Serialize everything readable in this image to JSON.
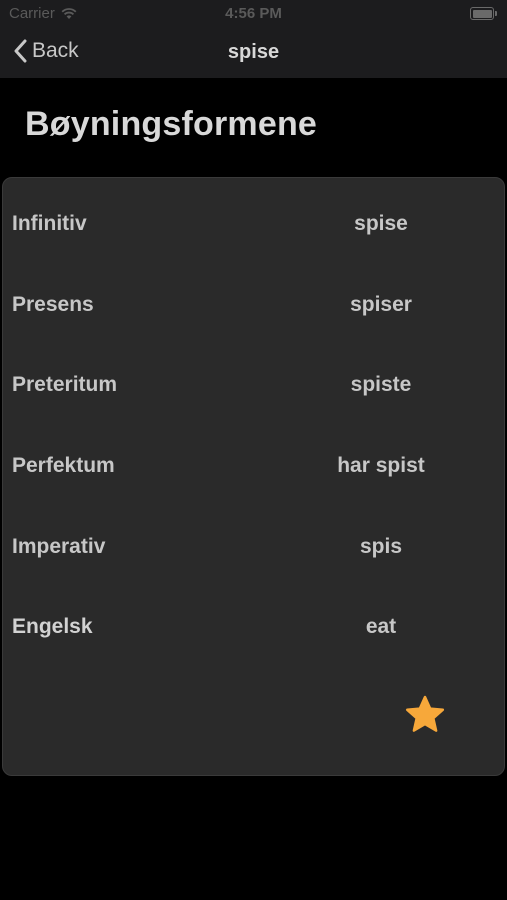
{
  "status_bar": {
    "carrier": "Carrier",
    "time": "4:56 PM"
  },
  "nav": {
    "back_label": "Back",
    "title": "spise"
  },
  "page": {
    "title": "Bøyningsformene"
  },
  "conjugations": [
    {
      "label": "Infinitiv",
      "value": "spise"
    },
    {
      "label": "Presens",
      "value": "spiser"
    },
    {
      "label": "Preteritum",
      "value": "spiste"
    },
    {
      "label": "Perfektum",
      "value": "har spist"
    },
    {
      "label": "Imperativ",
      "value": "spis"
    },
    {
      "label": "Engelsk",
      "value": "eat"
    }
  ],
  "icons": {
    "favorite": "star-icon",
    "back": "chevron-left-icon",
    "wifi": "wifi-icon",
    "battery": "battery-icon"
  },
  "colors": {
    "background": "#000000",
    "card": "#2a2a2a",
    "bar": "#1c1c1e",
    "star": "#f7a83a",
    "text": "#c7c7c7"
  }
}
